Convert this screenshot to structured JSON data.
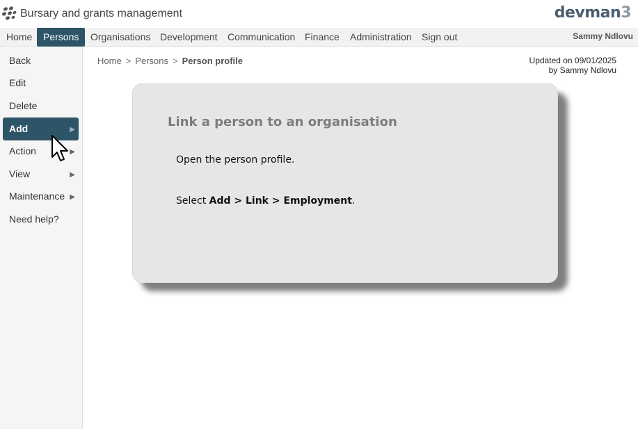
{
  "app": {
    "title": "Bursary and grants management",
    "brand_text": "devman",
    "brand_num": "3"
  },
  "topnav": {
    "items": [
      {
        "label": "Home"
      },
      {
        "label": "Persons"
      },
      {
        "label": "Organisations"
      },
      {
        "label": "Development"
      },
      {
        "label": "Communication"
      },
      {
        "label": "Finance"
      },
      {
        "label": "Administration"
      },
      {
        "label": "Sign out"
      }
    ],
    "active": "Persons",
    "user": "Sammy Ndlovu"
  },
  "sidebar": {
    "items": [
      {
        "label": "Back"
      },
      {
        "label": "Edit"
      },
      {
        "label": "Delete"
      },
      {
        "label": "Add",
        "arrow": "▶"
      },
      {
        "label": "Action",
        "arrow": "▶"
      },
      {
        "label": "View",
        "arrow": "▶"
      },
      {
        "label": "Maintenance",
        "arrow": "▶"
      },
      {
        "label": "Need help?"
      }
    ],
    "active": "Add"
  },
  "breadcrumb": {
    "items": [
      "Home",
      "Persons",
      "Person profile"
    ],
    "separator": ">"
  },
  "updated": {
    "line1": "Updated on 09/01/2025",
    "line2": "by Sammy Ndlovu"
  },
  "card": {
    "title": "Link a person to an organisation",
    "step1": "Open the person profile.",
    "step2_prefix": "Select ",
    "step2_bold": "Add > Link > Employment",
    "step2_suffix": "."
  },
  "colors": {
    "nav_active": "#2e5467",
    "brand": "#4a5e72",
    "card_bg": "#e6e6e6"
  },
  "icons": {
    "logo": "paw-logo-icon",
    "cursor": "mouse-pointer-icon",
    "submenu": "triangle-right-icon"
  }
}
